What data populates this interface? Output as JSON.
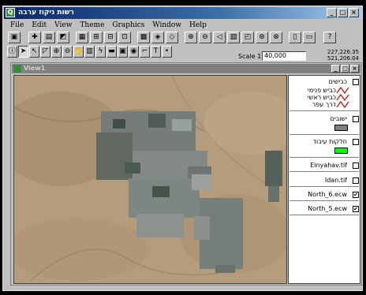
{
  "window": {
    "title": "רשות ניקוז ערבה"
  },
  "titlebar_buttons": [
    "_",
    "□",
    "×"
  ],
  "menu": [
    "File",
    "Edit",
    "View",
    "Theme",
    "Graphics",
    "Window",
    "Help"
  ],
  "scale": {
    "label": "Scale 1:",
    "value": "40,000"
  },
  "coords": {
    "x": "227,226.35",
    "y": "521,206.04"
  },
  "view": {
    "title": "View1"
  },
  "toc": {
    "roads_header": "כבישים",
    "road_types": [
      "כביש פנימי",
      "כביש ראשי",
      "דרך עפר"
    ],
    "settlements": "ישובים",
    "fields": "חלקות עיבוד",
    "layers": [
      {
        "label": "Einyahav.tif",
        "checked": false
      },
      {
        "label": "Idan.tif",
        "checked": false
      },
      {
        "label": "North_6.ecw",
        "checked": true
      },
      {
        "label": "North_5.ecw",
        "checked": true
      }
    ]
  },
  "colors": {
    "settlements_swatch": "#7f7f7f",
    "fields_swatch": "#00ff00",
    "road_icon": "#b03020"
  },
  "check_mark": "✔"
}
